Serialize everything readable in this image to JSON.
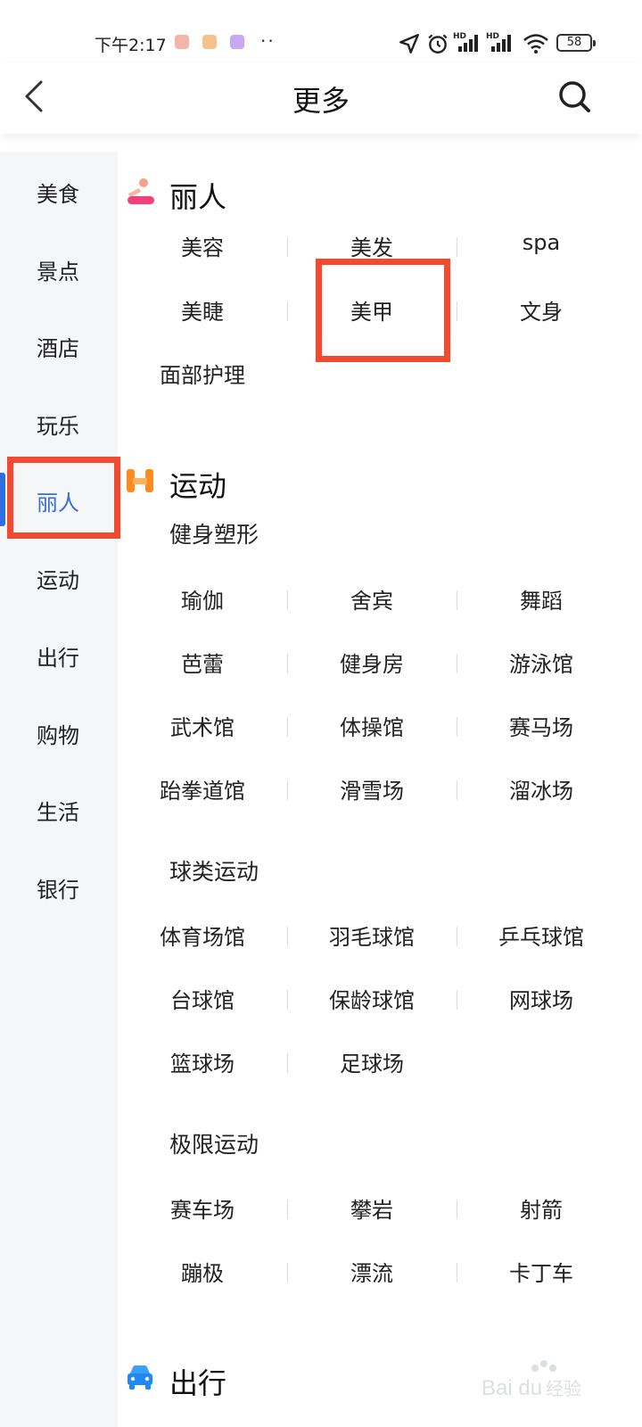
{
  "status_bar": {
    "time": "下午2:17",
    "battery": "58",
    "icons": [
      "location-icon",
      "alarm-icon",
      "hd-signal-icon",
      "hd-signal-icon",
      "wifi-icon",
      "battery-icon"
    ]
  },
  "header": {
    "title": "更多",
    "back_icon": "chevron-left-icon",
    "search_icon": "search-icon"
  },
  "sidebar": {
    "active_color": "#3a6fd0",
    "items": [
      {
        "label": "美食"
      },
      {
        "label": "景点"
      },
      {
        "label": "酒店"
      },
      {
        "label": "玩乐"
      },
      {
        "label": "丽人",
        "active": true
      },
      {
        "label": "运动"
      },
      {
        "label": "出行"
      },
      {
        "label": "购物"
      },
      {
        "label": "生活"
      },
      {
        "label": "银行"
      }
    ]
  },
  "sections": {
    "beauty": {
      "title": "丽人",
      "icon": "beauty-icon",
      "rows": [
        [
          "美容",
          "美发",
          "spa"
        ],
        [
          "美睫",
          "美甲",
          "文身"
        ],
        [
          "面部护理"
        ]
      ]
    },
    "sports": {
      "title": "运动",
      "icon": "sports-icon",
      "groups": [
        {
          "title": "健身塑形",
          "rows": [
            [
              "瑜伽",
              "舍宾",
              "舞蹈"
            ],
            [
              "芭蕾",
              "健身房",
              "游泳馆"
            ],
            [
              "武术馆",
              "体操馆",
              "赛马场"
            ],
            [
              "跆拳道馆",
              "滑雪场",
              "溜冰场"
            ]
          ]
        },
        {
          "title": "球类运动",
          "rows": [
            [
              "体育场馆",
              "羽毛球馆",
              "乒乓球馆"
            ],
            [
              "台球馆",
              "保龄球馆",
              "网球场"
            ],
            [
              "篮球场",
              "足球场"
            ]
          ]
        },
        {
          "title": "极限运动",
          "rows": [
            [
              "赛车场",
              "攀岩",
              "射箭"
            ],
            [
              "蹦极",
              "漂流",
              "卡丁车"
            ]
          ]
        }
      ]
    },
    "travel": {
      "title": "出行",
      "icon": "car-icon"
    }
  },
  "highlight_color": "#f04a30",
  "watermark": "Baidu经验"
}
